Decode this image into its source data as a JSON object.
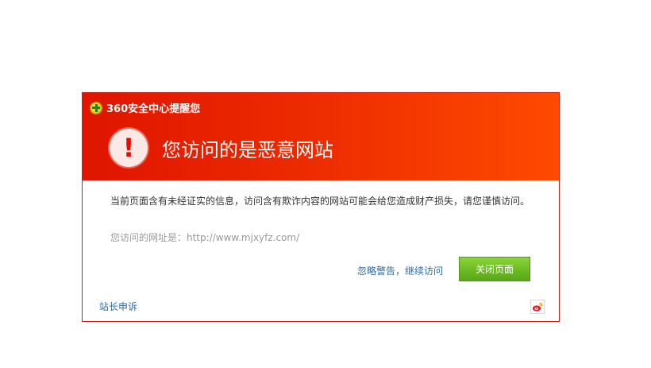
{
  "header": {
    "brand": "360安全中心提醒您",
    "title": "您访问的是恶意网站",
    "alert_glyph": "!",
    "icons": [
      "brand-logo-icon",
      "exclamation-icon"
    ]
  },
  "body": {
    "message": "当前页面含有未经证实的信息，访问含有欺诈内容的网站可能会给您造成财产损失，请您谨慎访问。",
    "url_line": "您访问的网址是：http://www.mjxyfz.com/",
    "ignore_link": "忽略警告，继续访问",
    "close_button": "关闭页面"
  },
  "footer": {
    "appeal_link": "站长申诉",
    "icons": [
      "weibo-icon"
    ]
  },
  "colors": {
    "header_start": "#df1500",
    "header_end": "#ff4a00",
    "link": "#2b6aa3",
    "button_green": "#6cbb22",
    "border": "#c9201a"
  }
}
